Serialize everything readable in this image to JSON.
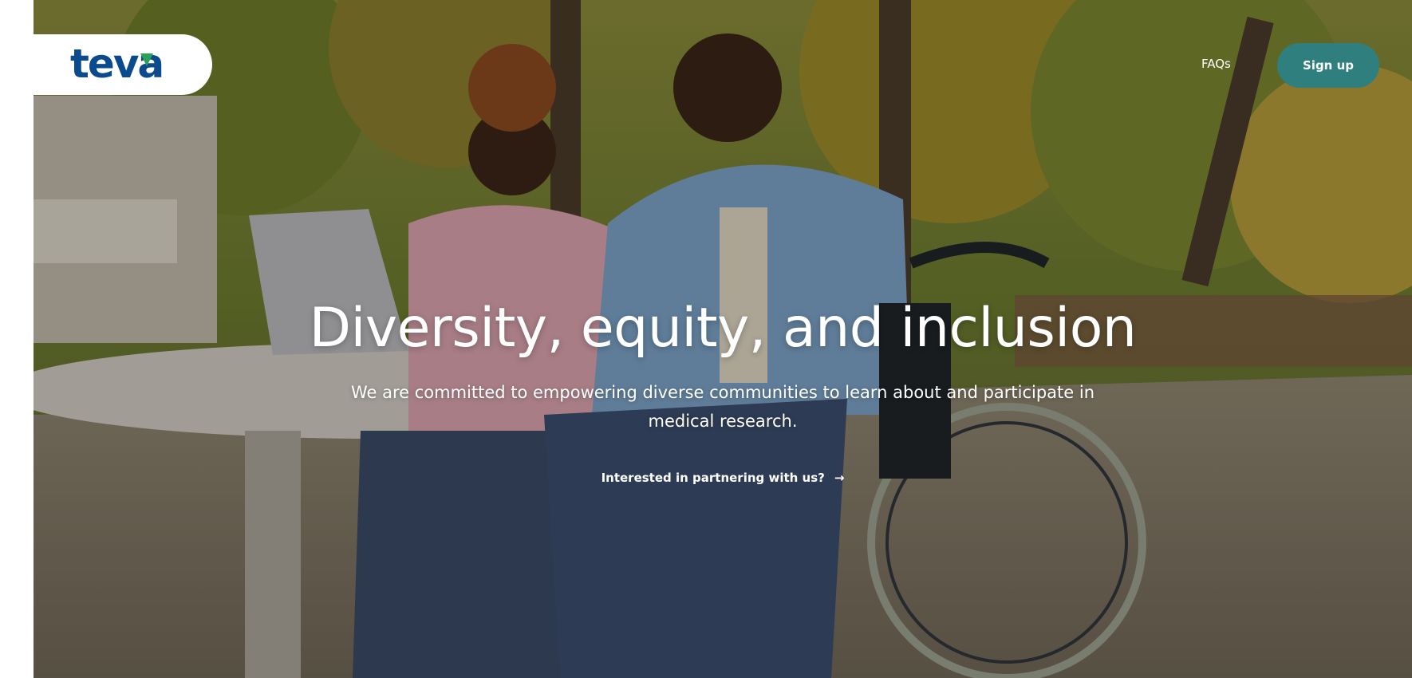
{
  "brand": {
    "logo_text": "teva",
    "logo_color": "#0b4a8c",
    "leaf_color": "#2aa05a"
  },
  "nav": {
    "faqs_label": "FAQs",
    "signup_label": "Sign up"
  },
  "hero": {
    "title": "Diversity, equity, and inclusion",
    "subtitle": "We are committed to empowering diverse communities to learn about and participate in medical research.",
    "cta_label": "Interested in partnering with us?",
    "cta_icon": "arrow-right-icon"
  },
  "colors": {
    "accent": "#2f7f7f",
    "text_on_hero": "#ffffff"
  }
}
